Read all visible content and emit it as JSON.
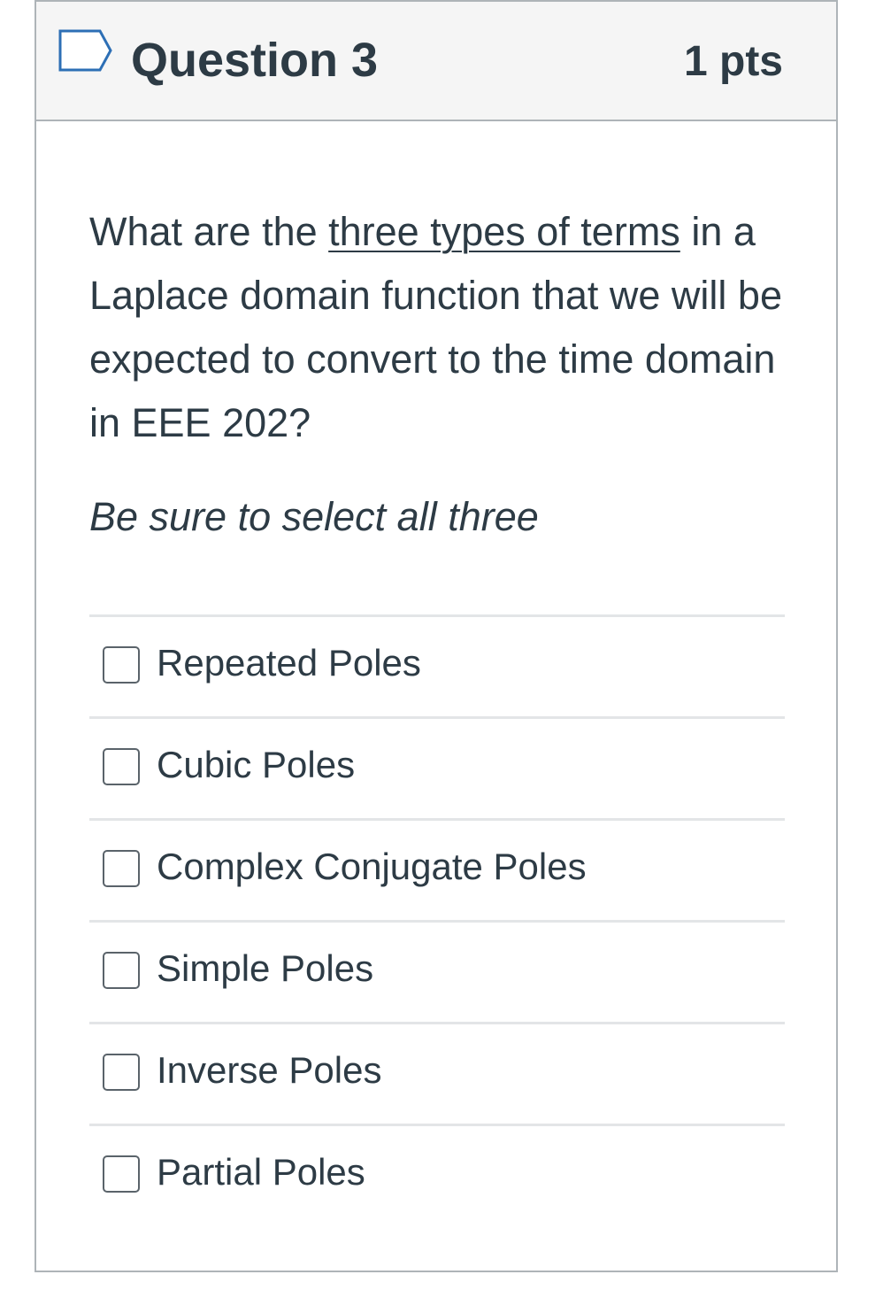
{
  "header": {
    "title": "Question 3",
    "points": "1 pts",
    "flag_icon": "flag-outline-icon"
  },
  "question": {
    "text_before": "What are the ",
    "text_underlined": "three types of terms",
    "text_after": " in a Laplace domain function that we will be expected to convert to the time domain in EEE 202?",
    "instruction": "Be sure to select all three"
  },
  "answers": [
    {
      "label": "Repeated Poles",
      "checked": false
    },
    {
      "label": "Cubic Poles",
      "checked": false
    },
    {
      "label": "Complex Conjugate Poles",
      "checked": false
    },
    {
      "label": "Simple Poles",
      "checked": false
    },
    {
      "label": "Inverse Poles",
      "checked": false
    },
    {
      "label": "Partial Poles",
      "checked": false
    }
  ],
  "colors": {
    "text": "#2d3b45",
    "header_bg": "#f5f5f5",
    "border": "#aeb4b8",
    "divider": "#e3e5e7",
    "flag_outline": "#2d6fb5"
  }
}
